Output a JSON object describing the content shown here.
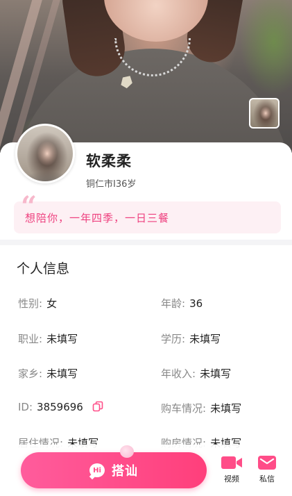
{
  "profile": {
    "name": "软柔柔",
    "city": "铜仁市",
    "separator": "I",
    "age_text": "36岁",
    "quote": "想陪你，一年四季，一日三餐"
  },
  "info": {
    "title": "个人信息",
    "rows": [
      {
        "label": "性别:",
        "value": "女"
      },
      {
        "label": "年龄:",
        "value": "36"
      },
      {
        "label": "职业:",
        "value": "未填写"
      },
      {
        "label": "学历:",
        "value": "未填写"
      },
      {
        "label": "家乡:",
        "value": "未填写"
      },
      {
        "label": "年收入:",
        "value": "未填写"
      },
      {
        "label": "ID:",
        "value": "3859696"
      },
      {
        "label": "购车情况:",
        "value": "未填写"
      },
      {
        "label": "居住情况:",
        "value": "未填写"
      },
      {
        "label": "购房情况:",
        "value": "未填写"
      }
    ]
  },
  "actions": {
    "greet_icon_text": "Hi",
    "greet_label": "搭讪",
    "video_label": "视频",
    "message_label": "私信"
  },
  "colors": {
    "accent": "#ff4d88",
    "quote_text": "#ee3f7e",
    "quote_bg": "#fdf0f4"
  },
  "icons": [
    "copy-icon",
    "video-icon",
    "message-icon",
    "hi-chat-icon",
    "quote-mark-icon"
  ]
}
